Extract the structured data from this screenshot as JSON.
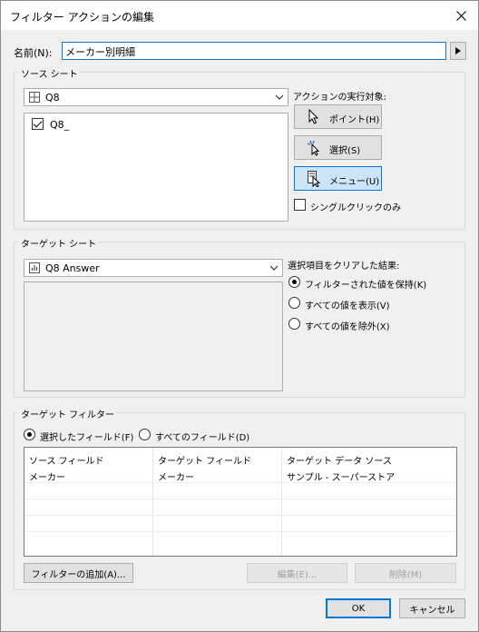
{
  "window": {
    "title": "フィルター アクションの編集"
  },
  "name_field": {
    "label": "名前(N):",
    "value": "メーカー別明細"
  },
  "source_sheets": {
    "group_title": "ソース シート",
    "selected_sheet": "Q8",
    "items": [
      {
        "label": "Q8_",
        "checked": true
      }
    ]
  },
  "run_action_on": {
    "label": "アクションの実行対象:",
    "buttons": [
      {
        "label": "ポイント(H)",
        "icon": "pointer-icon",
        "selected": false
      },
      {
        "label": "選択(S)",
        "icon": "select-click-icon",
        "selected": false
      },
      {
        "label": "メニュー(U)",
        "icon": "menu-icon",
        "selected": true
      }
    ],
    "single_click_only": {
      "label": "シングルクリックのみ",
      "checked": false
    }
  },
  "target_sheets": {
    "group_title": "ターゲット シート",
    "selected_sheet": "Q8 Answer"
  },
  "clearing_selection": {
    "label": "選択項目をクリアした結果:",
    "options": [
      {
        "label": "フィルターされた値を保持(K)",
        "checked": true
      },
      {
        "label": "すべての値を表示(V)",
        "checked": false
      },
      {
        "label": "すべての値を除外(X)",
        "checked": false
      }
    ]
  },
  "target_filters": {
    "group_title": "ターゲット フィルター",
    "options": [
      {
        "label": "選択したフィールド(F)",
        "checked": true
      },
      {
        "label": "すべてのフィールド(D)",
        "checked": false
      }
    ],
    "columns": [
      "ソース フィールド",
      "ターゲット フィールド",
      "ターゲット データ ソース"
    ],
    "rows": [
      [
        "メーカー",
        "メーカー",
        "サンプル - スーパーストア"
      ]
    ]
  },
  "buttons": {
    "add_filter": "フィルターの追加(A)...",
    "edit": "編集(E)...",
    "remove": "削除(M)",
    "ok": "OK",
    "cancel": "キャンセル"
  },
  "colors": {
    "accent": "#0078d7",
    "selected_button_bg": "#cce4f7",
    "dialog_bg": "#f0f0f0"
  }
}
